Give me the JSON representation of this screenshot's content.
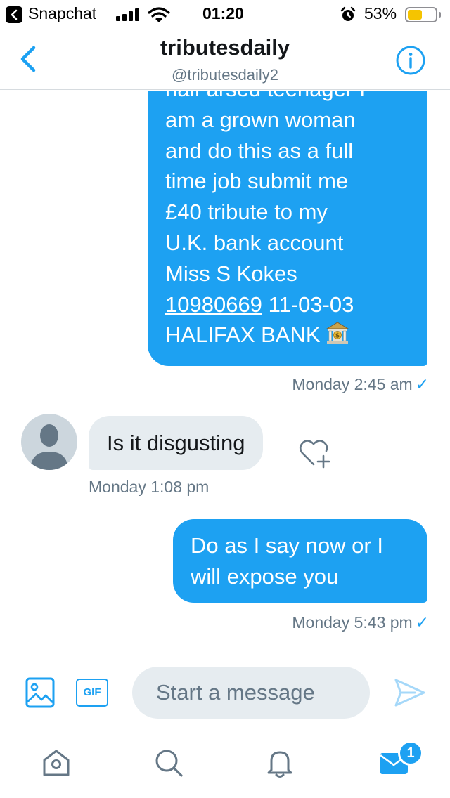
{
  "status_bar": {
    "back_app": "Snapchat",
    "time": "01:20",
    "battery": "53%",
    "battery_level": 0.53,
    "icons": [
      "signal-icon",
      "wifi-icon",
      "alarm-icon",
      "battery-icon"
    ]
  },
  "header": {
    "title": "tributesdaily",
    "handle": "@tributesdaily2"
  },
  "messages": [
    {
      "direction": "outgoing",
      "lines": [
        "half arsed teenager I",
        "am a grown woman",
        "and do this as a full",
        "time job submit me",
        "£40 tribute to my",
        "U.K. bank account",
        "Miss S Kokes"
      ],
      "account_number": "10980669",
      "sort_code": "11-03-03",
      "bank_line": "HALIFAX BANK",
      "emoji": "bank-icon",
      "timestamp": "Monday 2:45 am"
    },
    {
      "direction": "incoming",
      "text": "Is it disgusting",
      "timestamp": "Monday 1:08 pm"
    },
    {
      "direction": "outgoing",
      "lines": [
        "Do as I say now or I",
        "will expose you"
      ],
      "timestamp": "Monday 5:43 pm"
    }
  ],
  "composer": {
    "placeholder": "Start a message",
    "gif_label": "GIF"
  },
  "tab_bar": {
    "tabs": [
      "home-icon",
      "search-icon",
      "notifications-icon",
      "messages-icon"
    ],
    "messages_badge": "1"
  },
  "colors": {
    "accent": "#1da1f2",
    "incoming_bubble": "#e6ecf0",
    "muted_text": "#657786",
    "battery": "#f5c400"
  }
}
